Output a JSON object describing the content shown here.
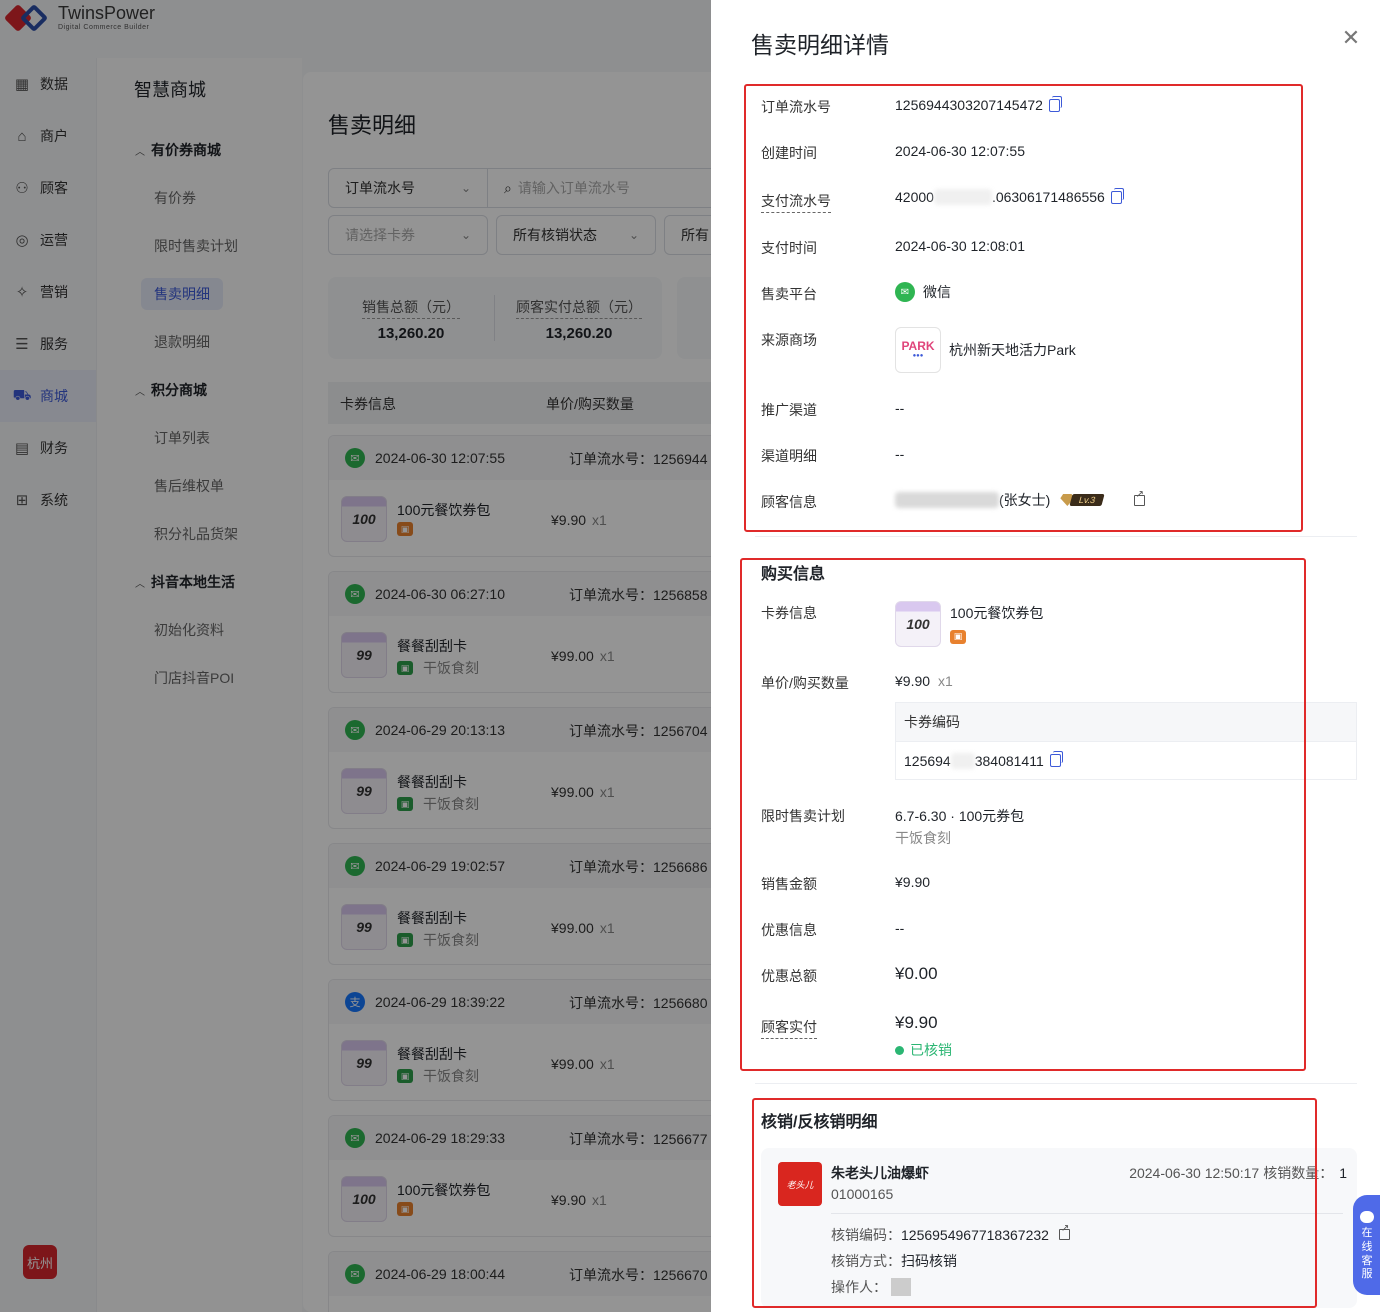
{
  "brand": {
    "name": "TwinsPower",
    "tagline": "Digital Commerce Builder"
  },
  "nav": {
    "items": [
      {
        "label": "数据",
        "icon": "chart-icon"
      },
      {
        "label": "商户",
        "icon": "store-icon"
      },
      {
        "label": "顾客",
        "icon": "users-icon"
      },
      {
        "label": "运营",
        "icon": "operation-icon"
      },
      {
        "label": "营销",
        "icon": "marketing-icon"
      },
      {
        "label": "服务",
        "icon": "service-icon"
      },
      {
        "label": "商城",
        "icon": "cart-icon"
      },
      {
        "label": "财务",
        "icon": "finance-icon"
      },
      {
        "label": "系统",
        "icon": "grid-icon"
      }
    ],
    "city": "杭州"
  },
  "subnav": {
    "title": "智慧商城",
    "groups": [
      {
        "label": "有价券商城",
        "items": [
          "有价券",
          "限时售卖计划",
          "售卖明细",
          "退款明细"
        ]
      },
      {
        "label": "积分商城",
        "items": [
          "订单列表",
          "售后维权单",
          "积分礼品货架"
        ]
      },
      {
        "label": "抖音本地生活",
        "items": [
          "初始化资料",
          "门店抖音POI"
        ]
      }
    ]
  },
  "page": {
    "title": "售卖明细",
    "filters": {
      "search_type": "订单流水号",
      "search_placeholder": "请输入订单流水号",
      "card_placeholder": "请选择卡券",
      "verify_status": "所有核销状态",
      "more": "所有"
    },
    "stats": [
      {
        "label": "销售总额（元）",
        "value": "13,260.20"
      },
      {
        "label": "顾客实付总额（元）",
        "value": "13,260.20"
      }
    ],
    "columns": [
      "卡券信息",
      "单价/购买数量"
    ],
    "order_prefix": "订单流水号：",
    "orders": [
      {
        "time": "2024-06-30 12:07:55",
        "order_no": "1256944",
        "name": "100元餐饮券包",
        "shop": "",
        "price": "¥9.90",
        "qty": "x1",
        "thumb": "100",
        "pay": "wechat"
      },
      {
        "time": "2024-06-30 06:27:10",
        "order_no": "1256858",
        "name": "餐餐刮刮卡",
        "shop": "干饭食刻",
        "price": "¥99.00",
        "qty": "x1",
        "thumb": "99",
        "pay": "wechat"
      },
      {
        "time": "2024-06-29 20:13:13",
        "order_no": "1256704",
        "name": "餐餐刮刮卡",
        "shop": "干饭食刻",
        "price": "¥99.00",
        "qty": "x1",
        "thumb": "99",
        "pay": "wechat"
      },
      {
        "time": "2024-06-29 19:02:57",
        "order_no": "1256686",
        "name": "餐餐刮刮卡",
        "shop": "干饭食刻",
        "price": "¥99.00",
        "qty": "x1",
        "thumb": "99",
        "pay": "wechat"
      },
      {
        "time": "2024-06-29 18:39:22",
        "order_no": "1256680",
        "name": "餐餐刮刮卡",
        "shop": "干饭食刻",
        "price": "¥99.00",
        "qty": "x1",
        "thumb": "99",
        "pay": "alipay"
      },
      {
        "time": "2024-06-29 18:29:33",
        "order_no": "1256677",
        "name": "100元餐饮券包",
        "shop": "",
        "price": "¥9.90",
        "qty": "x1",
        "thumb": "100",
        "pay": "wechat"
      },
      {
        "time": "2024-06-29 18:00:44",
        "order_no": "1256670",
        "name": "",
        "shop": "",
        "price": "",
        "qty": "",
        "thumb": "",
        "pay": "wechat"
      }
    ]
  },
  "drawer": {
    "title": "售卖明细详情",
    "close_icon": "close-icon",
    "basic": {
      "order_no_label": "订单流水号",
      "order_no": "1256944303207145472",
      "created_label": "创建时间",
      "created": "2024-06-30 12:07:55",
      "pay_no_label": "支付流水号",
      "pay_no_head": "42000",
      "pay_no_tail": ".06306171486556",
      "pay_time_label": "支付时间",
      "pay_time": "2024-06-30 12:08:01",
      "platform_label": "售卖平台",
      "platform": "微信",
      "mall_label": "来源商场",
      "mall": "杭州新天地活力Park",
      "channel_label": "推广渠道",
      "channel": "--",
      "channel_detail_label": "渠道明细",
      "channel_detail": "--",
      "customer_label": "顾客信息",
      "customer_name": "(张女士)",
      "customer_level": "Lv.3"
    },
    "purchase": {
      "title": "购买信息",
      "card_label": "卡券信息",
      "card_name": "100元餐饮券包",
      "card_thumb": "100",
      "price_label": "单价/购买数量",
      "price": "¥9.90",
      "qty": "x1",
      "code_header": "卡券编码",
      "code_head": "125694",
      "code_tail": "384081411",
      "plan_label": "限时售卖计划",
      "plan": "6.7-6.30 · 100元券包",
      "plan_shop": "干饭食刻",
      "sales_label": "销售金额",
      "sales": "¥9.90",
      "discount_label": "优惠信息",
      "discount": "--",
      "discount_total_label": "优惠总额",
      "discount_total": "¥0.00",
      "paid_label": "顾客实付",
      "paid": "¥9.90",
      "status": "已核销"
    },
    "verify": {
      "title": "核销/反核销明细",
      "store": "朱老头儿油爆虾",
      "store_code": "01000165",
      "time": "2024-06-30 12:50:17",
      "count_label": "核销数量：",
      "count": "1",
      "code_label": "核销编码：",
      "code": "1256954967718367232",
      "method_label": "核销方式：",
      "method": "扫码核销",
      "operator_label": "操作人："
    }
  },
  "support": {
    "label_lines": [
      "在",
      "线",
      "客",
      "服"
    ]
  },
  "colors": {
    "accent": "#3d5ad8",
    "wechat": "#2fb552",
    "alipay": "#1677ff",
    "status_green": "#2bb673",
    "highlight_red": "#e02a2a"
  }
}
